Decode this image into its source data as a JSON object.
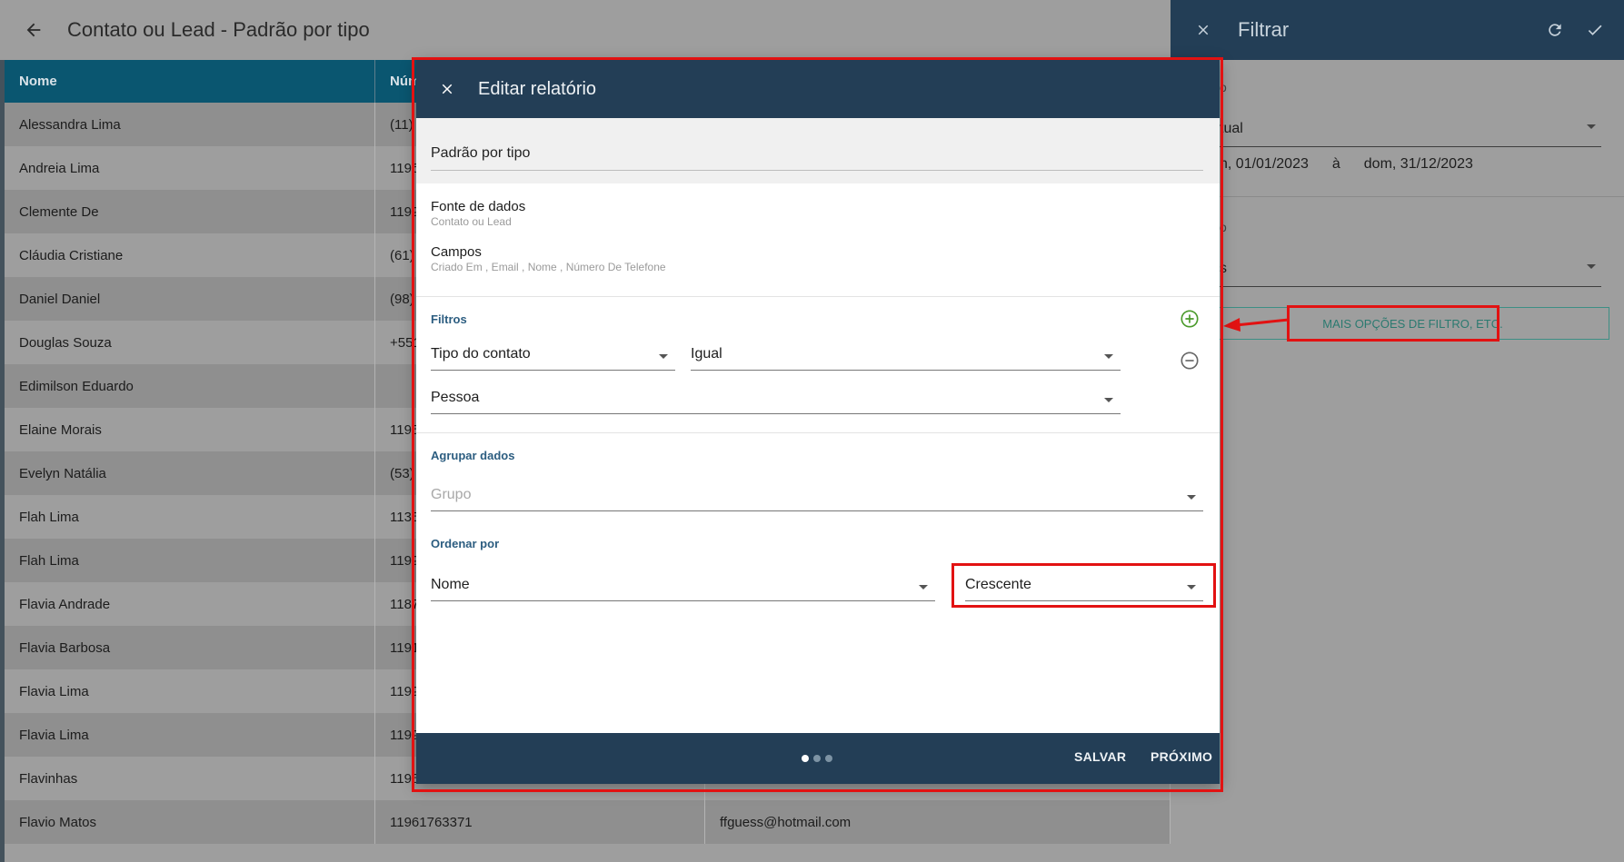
{
  "page": {
    "title": "Contato ou Lead - Padrão por tipo",
    "back_icon": "arrow-left-icon"
  },
  "table": {
    "columns": [
      "Nome",
      "Núm",
      ""
    ],
    "rows": [
      {
        "name": "Alessandra Lima",
        "phone": "(11)",
        "email": ""
      },
      {
        "name": "Andreia Lima",
        "phone": "1196",
        "email": ""
      },
      {
        "name": "Clemente De",
        "phone": "1199",
        "email": ""
      },
      {
        "name": "Cláudia Cristiane",
        "phone": "(61)",
        "email": ""
      },
      {
        "name": "Daniel Daniel",
        "phone": "(98)",
        "email": ""
      },
      {
        "name": "Douglas Souza",
        "phone": "+551",
        "email": ""
      },
      {
        "name": "Edimilson Eduardo",
        "phone": "",
        "email": ""
      },
      {
        "name": "Elaine Morais",
        "phone": "1195",
        "email": ""
      },
      {
        "name": "Evelyn Natália",
        "phone": "(53)",
        "email": ""
      },
      {
        "name": "Flah Lima",
        "phone": "1135",
        "email": ""
      },
      {
        "name": "Flah Lima",
        "phone": "1199",
        "email": ""
      },
      {
        "name": "Flavia Andrade",
        "phone": "1187",
        "email": ""
      },
      {
        "name": "Flavia Barbosa",
        "phone": "1191",
        "email": ""
      },
      {
        "name": "Flavia Lima",
        "phone": "1199",
        "email": ""
      },
      {
        "name": "Flavia Lima",
        "phone": "1199",
        "email": ""
      },
      {
        "name": "Flavinhas",
        "phone": "1195",
        "email": ""
      },
      {
        "name": "Flavio Matos",
        "phone": "11961763371",
        "email": "ffguess@hotmail.com"
      }
    ]
  },
  "filter_panel": {
    "title": "Filtrar",
    "label1": "o",
    "period_value": "tual",
    "date_from": "n, 01/01/2023",
    "date_sep": "à",
    "date_to": "dom, 31/12/2023",
    "label2": "o",
    "select2_value": "s",
    "more_button": "MAIS OPÇÕES DE FILTRO, ETC.",
    "icons": {
      "close": "close-icon",
      "refresh": "refresh-icon",
      "confirm": "check-icon"
    }
  },
  "modal": {
    "title": "Editar relatório",
    "report_name": "Padrão por tipo",
    "data_source": {
      "label": "Fonte de dados",
      "value": "Contato ou Lead"
    },
    "fields": {
      "label": "Campos",
      "value": "Criado Em , Email , Nome , Número De Telefone"
    },
    "filters": {
      "title": "Filtros",
      "field": "Tipo do contato",
      "operator": "Igual",
      "value": "Pessoa"
    },
    "group": {
      "title": "Agrupar dados",
      "placeholder": "Grupo"
    },
    "order": {
      "title": "Ordenar por",
      "field": "Nome",
      "direction": "Crescente"
    },
    "footer": {
      "save": "SALVAR",
      "next": "PRÓXIMO",
      "steps_total": 3,
      "current_step": 1
    }
  },
  "colors": {
    "header_dark": "#233e56",
    "table_header": "#0a5670",
    "accent_green": "#4a9a2a",
    "section_blue": "#2c5d80",
    "annotation_red": "#e21212"
  }
}
